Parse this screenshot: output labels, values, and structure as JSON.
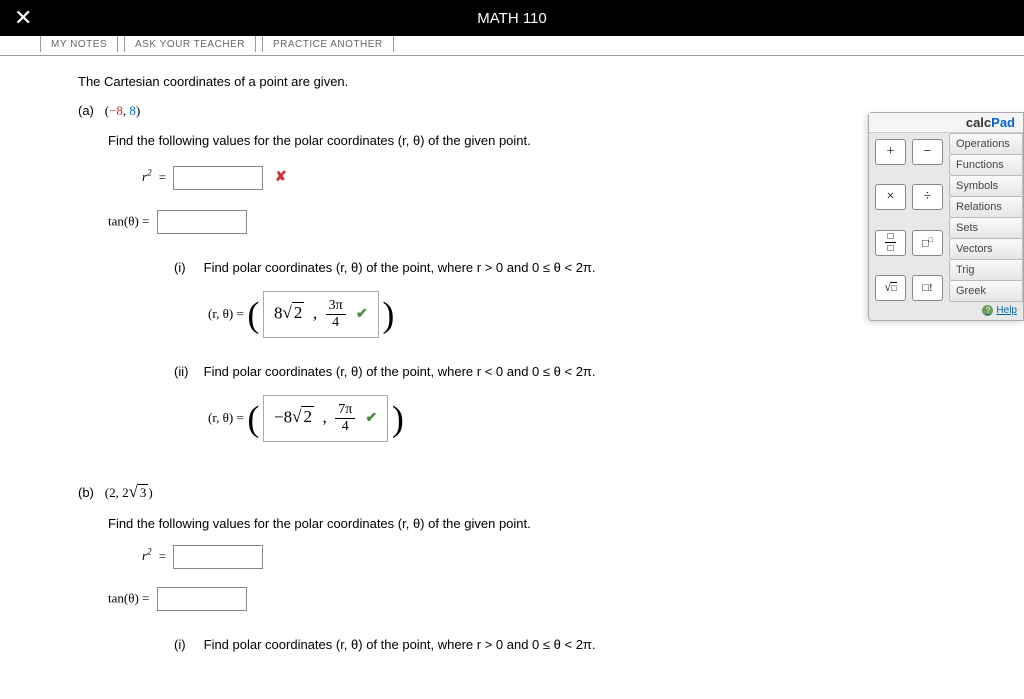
{
  "header": {
    "title": "MATH 110",
    "close": "✕"
  },
  "tabs": [
    "MY NOTES",
    "ASK YOUR TEACHER",
    "PRACTICE ANOTHER"
  ],
  "q": {
    "intro": "The Cartesian coordinates of a point are given.",
    "find_polar": "Find the following values for the polar coordinates (r, θ) of the given point.",
    "r2_label": "r",
    "tan_label": "tan(θ)  =",
    "eq": "=",
    "rtheta_label": "(r, θ) =",
    "a": {
      "label": "(a)",
      "point_prefix": "(",
      "point_x": "−8",
      "point_sep": ", ",
      "point_y": "8",
      "point_suffix": ")",
      "i_label": "(i)",
      "i_text": "Find polar coordinates (r, θ) of the point, where r > 0 and 0 ≤ θ < 2π.",
      "i_ans_r": "8√2",
      "i_ans_theta_num": "3π",
      "i_ans_theta_den": "4",
      "ii_label": "(ii)",
      "ii_text": "Find polar coordinates (r, θ) of the point, where r < 0 and 0 ≤ θ < 2π.",
      "ii_ans_r": "−8√2",
      "ii_ans_theta_num": "7π",
      "ii_ans_theta_den": "4"
    },
    "b": {
      "label": "(b)",
      "point": "(2, 2√3)",
      "i_label": "(i)",
      "i_text": "Find polar coordinates (r, θ) of the point, where r > 0 and 0 ≤ θ < 2π."
    }
  },
  "calcpad": {
    "title1": "calc",
    "title2": "Pad",
    "btns": [
      "+",
      "−",
      "×",
      "÷",
      "frac",
      "exp",
      "√□",
      "n!"
    ],
    "cats": [
      "Operations",
      "Functions",
      "Symbols",
      "Relations",
      "Sets",
      "Vectors",
      "Trig",
      "Greek"
    ],
    "help": "Help"
  }
}
